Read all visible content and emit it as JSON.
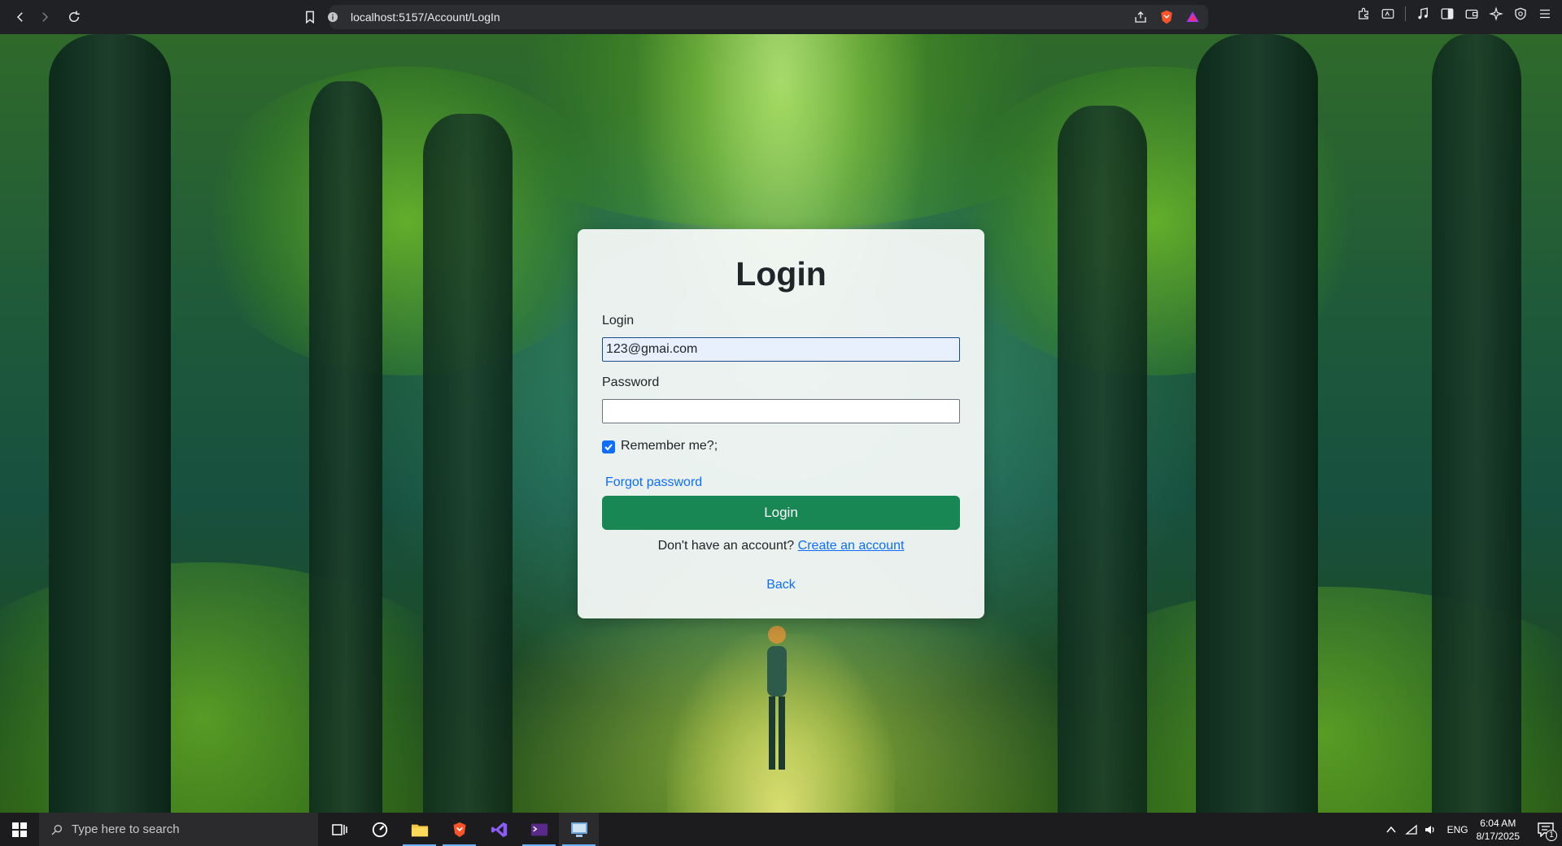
{
  "browser": {
    "url": "localhost:5157/Account/LogIn"
  },
  "login_card": {
    "title": "Login",
    "login_label": "Login",
    "login_value": "123@gmai.com",
    "password_label": "Password",
    "password_value": "",
    "remember_label": "Remember me?;",
    "remember_checked": true,
    "forgot_link": "Forgot password",
    "login_button": "Login",
    "signup_prompt": "Don't have an account?",
    "signup_link": "Create an account",
    "back_link": "Back"
  },
  "taskbar": {
    "search_placeholder": "Type here to search",
    "language": "ENG",
    "time": "6:04 AM",
    "date": "8/17/2025",
    "notification_count": "1"
  },
  "colors": {
    "primary_button": "#198754",
    "link": "#0d6efd",
    "checkbox": "#0d6efd"
  }
}
